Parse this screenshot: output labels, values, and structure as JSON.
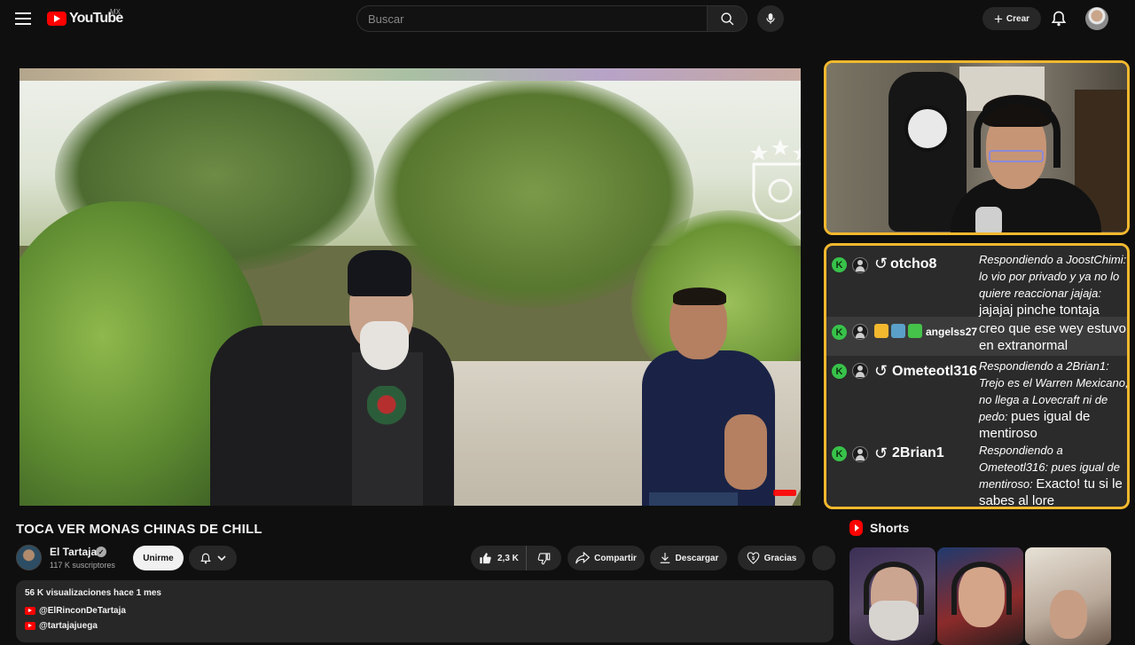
{
  "header": {
    "logo_text": "YouTube",
    "country_code": "MX",
    "search_placeholder": "Buscar",
    "create_label": "Crear"
  },
  "video": {
    "title": "TOCA VER MONAS CHINAS DE CHILL"
  },
  "channel": {
    "name": "El Tartaja",
    "subscribers": "117 K suscriptores",
    "join_label": "Unirme"
  },
  "actions": {
    "likes": "2,3 K",
    "share_label": "Compartir",
    "download_label": "Descargar",
    "thanks_label": "Gracias"
  },
  "description": {
    "meta": "56 K visualizaciones  hace 1 mes",
    "links": [
      "@ElRinconDeTartaja",
      "@tartajajuega"
    ]
  },
  "stream_chat": {
    "messages": [
      {
        "user": "otcho8",
        "is_reply": true,
        "quote": "Respondiendo a JoostChimi: lo vio por privado y ya no lo quiere reaccionar jajaja:",
        "text": "jajajaj pinche tontaja"
      },
      {
        "user": "angelss27",
        "is_reply": false,
        "quote": "",
        "text": "creo que ese wey estuvo en extranormal"
      },
      {
        "user": "Ometeotl316",
        "is_reply": true,
        "quote": "Respondiendo a 2Brian1: Trejo es el Warren Mexicano, no llega a Lovecraft ni de pedo:",
        "text": "pues igual de mentiroso"
      },
      {
        "user": "2Brian1",
        "is_reply": true,
        "quote": "Respondiendo a Ometeotl316: pues igual de mentiroso:",
        "text": "Exacto! tu si le sabes al lore"
      }
    ],
    "badge_letter": "K"
  },
  "shorts": {
    "title": "Shorts"
  },
  "colors": {
    "accent": "#ff0000",
    "overlay_border": "#f2b82e",
    "chat_badge": "#38c24a",
    "background": "#0f0f0f"
  },
  "icons": [
    "menu-icon",
    "search-icon",
    "mic-icon",
    "plus-icon",
    "bell-icon",
    "like-icon",
    "dislike-icon",
    "share-icon",
    "download-icon",
    "thanks-icon",
    "reply-icon",
    "verified-icon",
    "chevron-down-icon",
    "shorts-icon"
  ]
}
